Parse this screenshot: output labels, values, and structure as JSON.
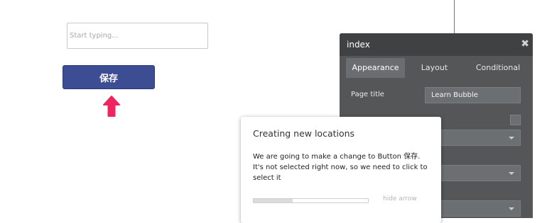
{
  "canvas": {
    "input_placeholder": "Start typing...",
    "button_label": "保存"
  },
  "property_editor": {
    "title": "index",
    "tabs": [
      {
        "label": "Appearance",
        "active": true
      },
      {
        "label": "Layout",
        "active": false
      },
      {
        "label": "Conditional",
        "active": false
      }
    ],
    "page_title_label": "Page title",
    "page_title_value": "Learn Bubble"
  },
  "tutorial": {
    "title": "Creating new locations",
    "body": "We are going to make a change to Button 保存. It's not selected right now, so we need to click to select it",
    "progress": 0.34,
    "hide_label": "hide arrow"
  },
  "colors": {
    "accent_line": "#3b88c3",
    "button_bg": "#3d4d94",
    "arrow": "#f0245f",
    "editor_bg": "#545658",
    "editor_header": "#3f4143"
  },
  "icons": {
    "close": "close-icon",
    "hint_arrow": "up-arrow-icon",
    "dropdown": "chevron-down-icon"
  }
}
